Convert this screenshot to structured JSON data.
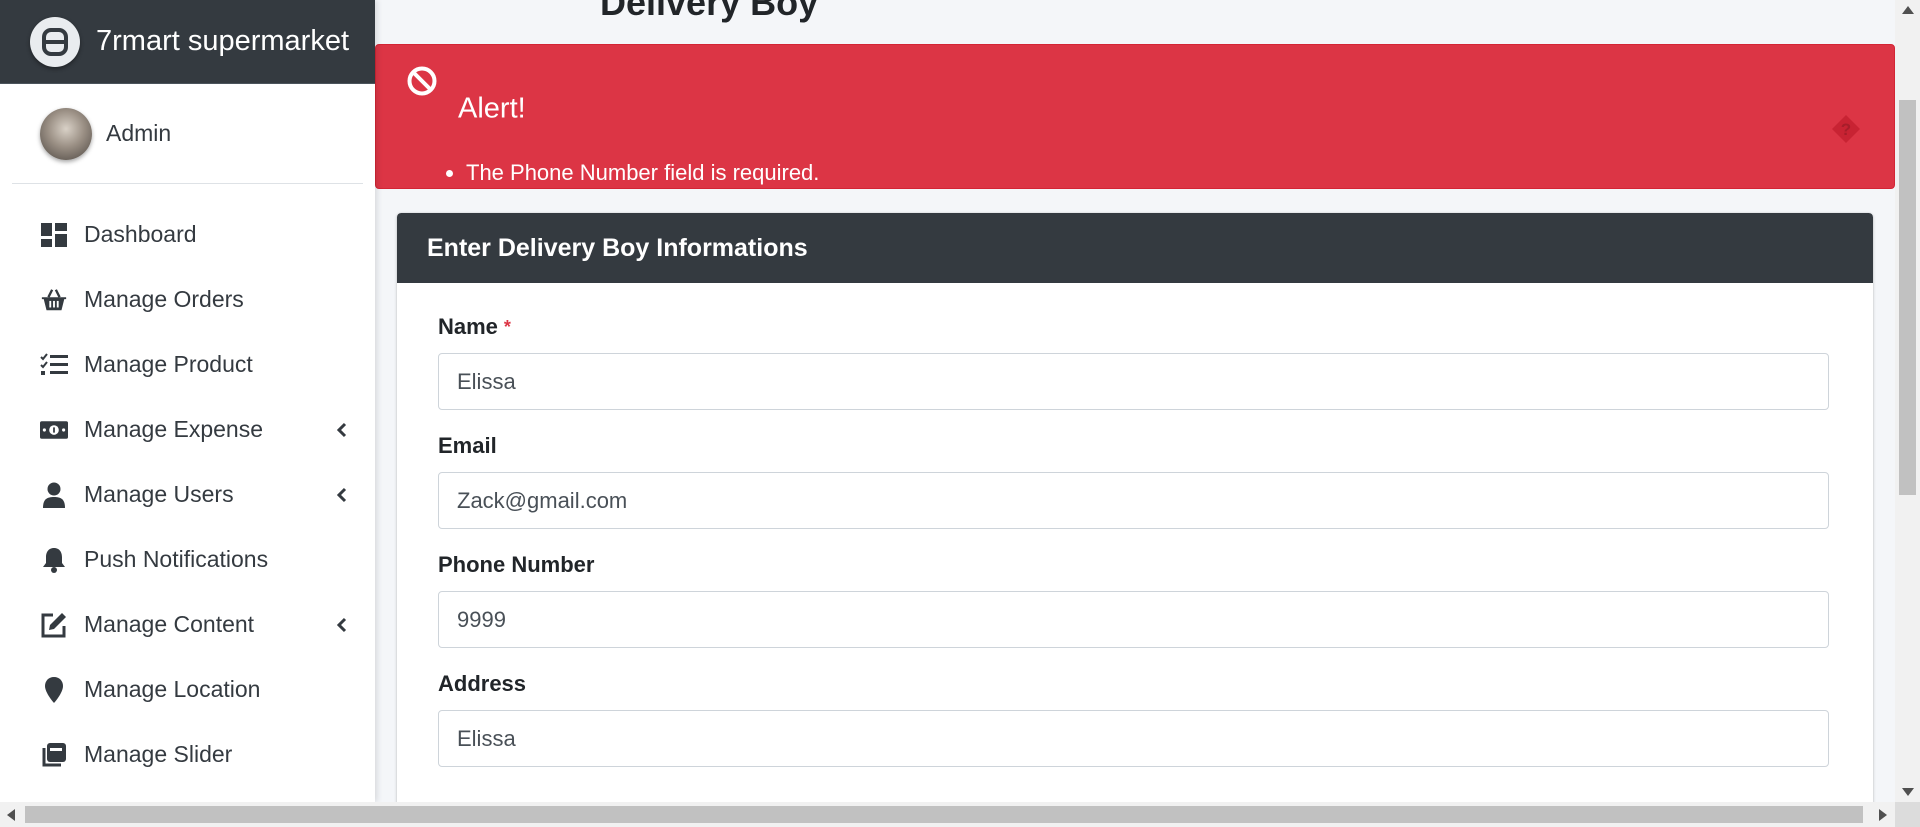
{
  "brand": {
    "name": "7rmart supermarket",
    "icon": "brand-logo-icon"
  },
  "user": {
    "name": "Admin"
  },
  "sidebar": {
    "items": [
      {
        "label": "Dashboard",
        "icon": "dashboard-icon",
        "expandable": false
      },
      {
        "label": "Manage Orders",
        "icon": "basket-icon",
        "expandable": false
      },
      {
        "label": "Manage Product",
        "icon": "list-check-icon",
        "expandable": false
      },
      {
        "label": "Manage Expense",
        "icon": "money-bill-icon",
        "expandable": true
      },
      {
        "label": "Manage Users",
        "icon": "user-icon",
        "expandable": true
      },
      {
        "label": "Push Notifications",
        "icon": "bell-icon",
        "expandable": false
      },
      {
        "label": "Manage Content",
        "icon": "edit-icon",
        "expandable": true
      },
      {
        "label": "Manage Location",
        "icon": "map-marker-icon",
        "expandable": false
      },
      {
        "label": "Manage Slider",
        "icon": "slider-icon",
        "expandable": false
      }
    ]
  },
  "page": {
    "title_peek": "Delivery Boy"
  },
  "alert": {
    "title": "Alert!",
    "messages": [
      "The Phone Number field is required."
    ],
    "color": "#dc3545"
  },
  "form": {
    "header": "Enter Delivery Boy Informations",
    "fields": {
      "name": {
        "label": "Name",
        "required_mark": "*",
        "value": "Elissa"
      },
      "email": {
        "label": "Email",
        "value": "Zack@gmail.com"
      },
      "phone": {
        "label": "Phone Number",
        "value": "9999"
      },
      "address": {
        "label": "Address",
        "value": "Elissa"
      }
    }
  },
  "colors": {
    "sidebar_brand_bg": "#343a40",
    "card_header_bg": "#343a40",
    "alert_bg": "#dc3545"
  }
}
